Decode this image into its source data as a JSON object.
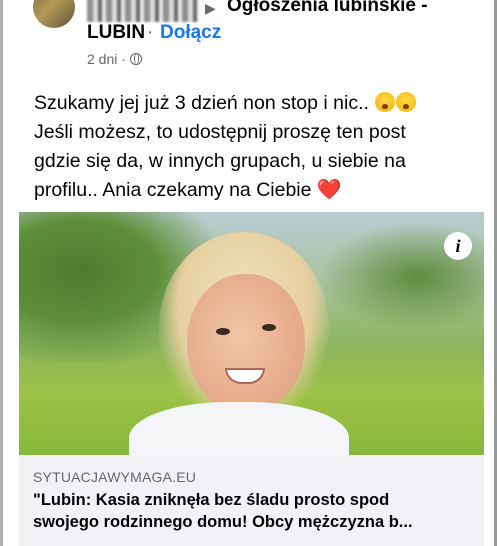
{
  "header": {
    "group_name_line1": "Ogłoszenia lubińskie -",
    "group_name_line2": "LUBIN",
    "separator": "·",
    "join_label": "Dołącz",
    "time": "2 dni",
    "meta_separator": "·"
  },
  "post": {
    "line1": "Szukamy jej już 3 dzień non stop i nic..",
    "line2": "Jeśli możesz, to udostępnij proszę ten post",
    "line3": "gdzie się da, w innych grupach, u siebie na",
    "line4": "profilu..  Ania czekamy na Ciebie",
    "heart": "❤️"
  },
  "link": {
    "domain": "SYTUACJAWYMAGA.EU",
    "headline_line1": "\"Lubin: Kasia zniknęła bez śladu prosto spod",
    "headline_line2": "swojego rodzinnego domu! Obcy mężczyzna b..."
  },
  "icons": {
    "info": "i",
    "arrow": "▶"
  },
  "colors": {
    "join": "#1877f2",
    "meta": "#65676b",
    "link_bg": "#f0f2f5"
  }
}
